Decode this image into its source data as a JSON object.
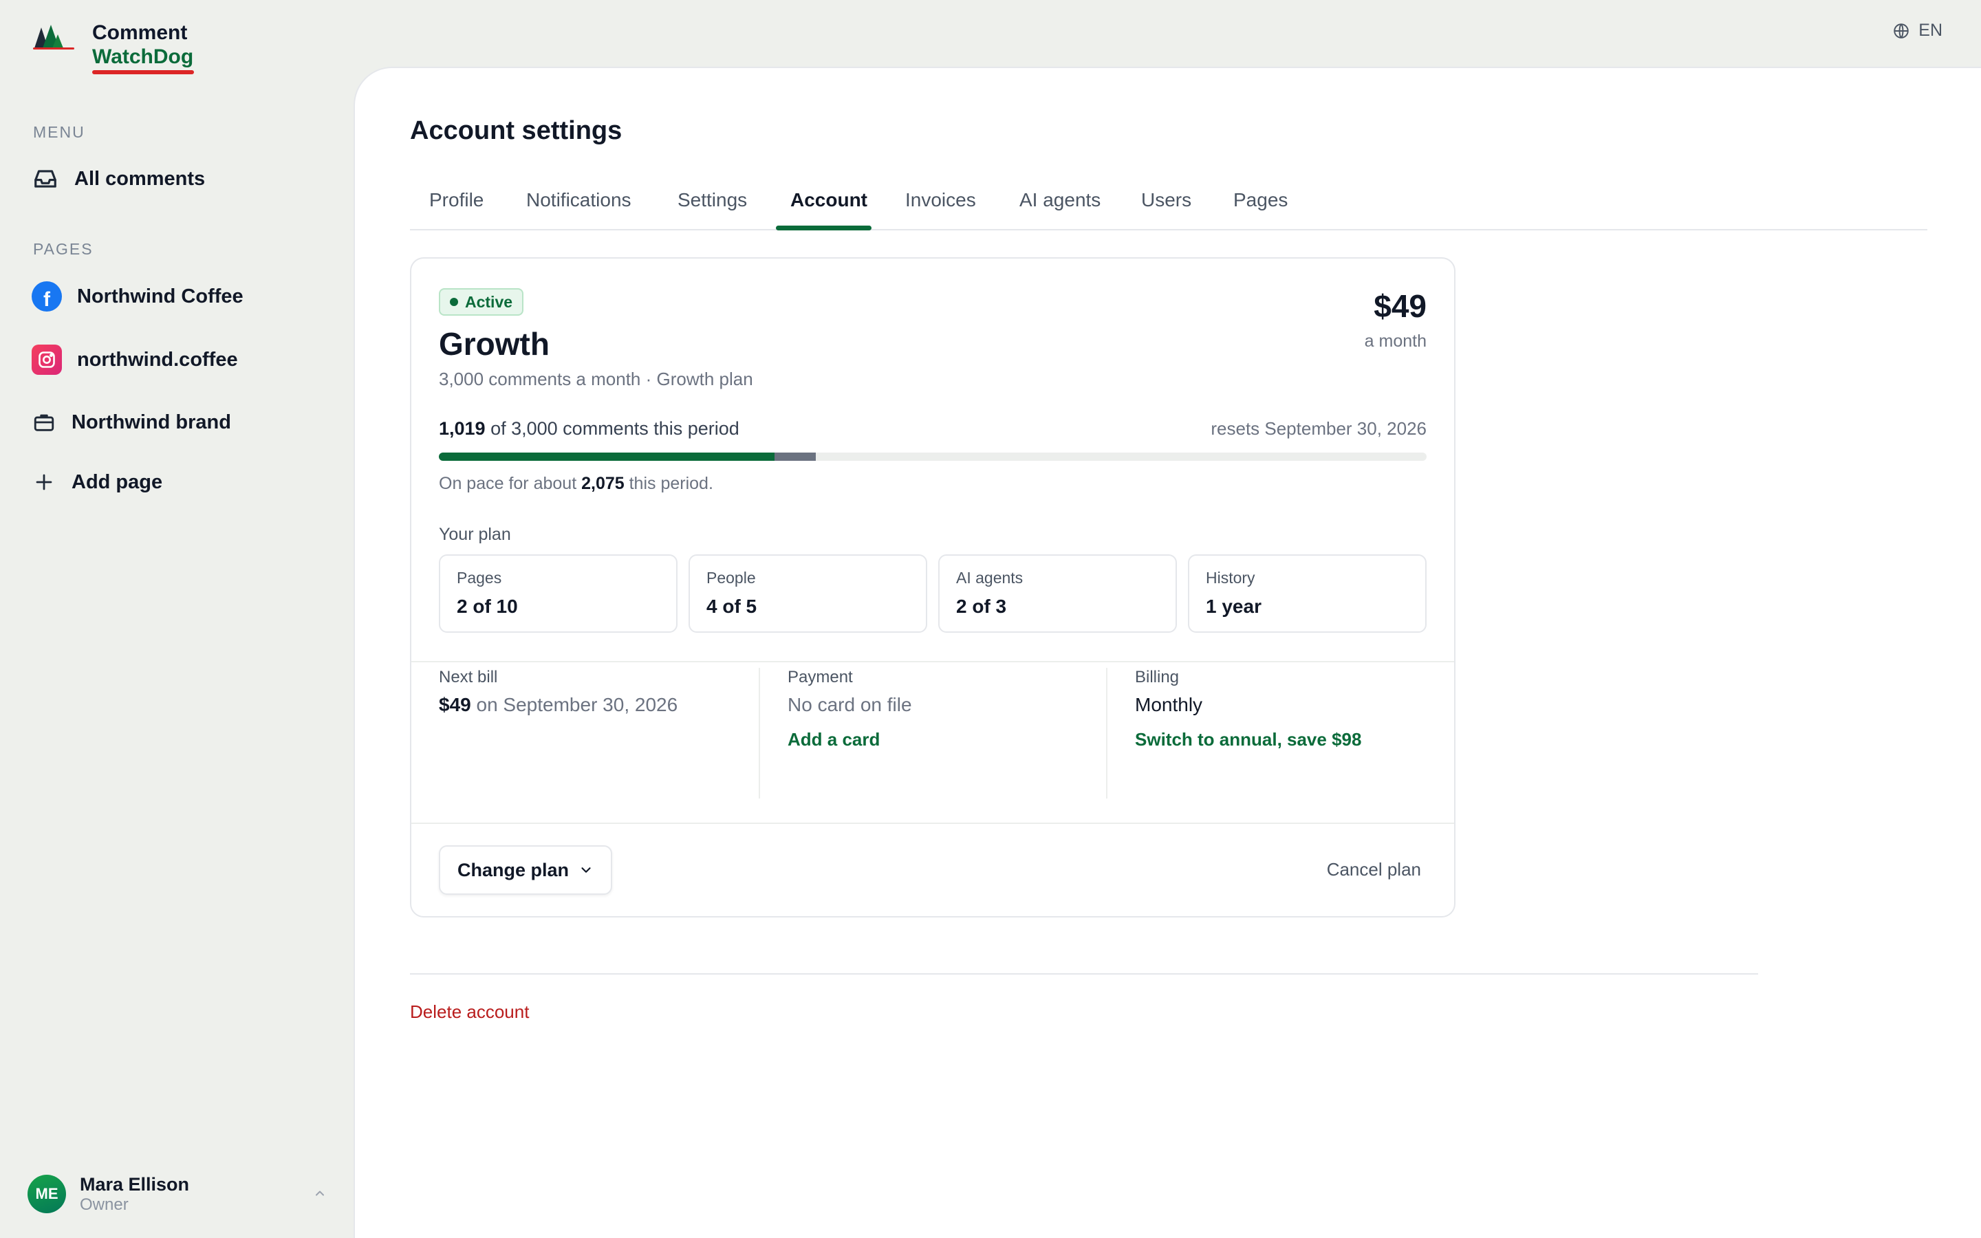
{
  "brand": {
    "line1": "Comment",
    "line2": "WatchDog"
  },
  "language": {
    "label": "EN",
    "icon": "globe-icon"
  },
  "sidebar": {
    "menu_label": "MENU",
    "menu_items": [
      {
        "label": "All comments",
        "icon": "inbox-icon"
      }
    ],
    "pages_label": "PAGES",
    "pages": [
      {
        "label": "Northwind Coffee",
        "icon": "facebook-icon"
      },
      {
        "label": "northwind.coffee",
        "icon": "instagram-icon"
      },
      {
        "label": "Northwind brand",
        "icon": "briefcase-icon"
      },
      {
        "label": "Add page",
        "icon": "plus-icon"
      }
    ]
  },
  "user": {
    "initials": "ME",
    "name": "Mara Ellison",
    "role": "Owner"
  },
  "main": {
    "title": "Account settings",
    "tabs": [
      "Profile",
      "Notifications",
      "Settings",
      "Account",
      "Invoices",
      "AI agents",
      "Users",
      "Pages"
    ],
    "active_tab": "Account"
  },
  "plan": {
    "status": "Active",
    "name": "Growth",
    "description": "3,000 comments a month · Growth plan",
    "price": "$49",
    "period": "a month",
    "usage": {
      "used": "1,019",
      "text": "of 3,000 comments this period",
      "reset": "resets September 30, 2026",
      "used_fraction": 0.3397,
      "projected_fraction": 0.3817,
      "pace_prefix": "On pace for about",
      "pace_value": "2,075",
      "pace_suffix": "this period."
    },
    "your_plan_label": "Your plan",
    "stats": [
      {
        "label": "Pages",
        "value": "2 of 10"
      },
      {
        "label": "People",
        "value": "4 of 5"
      },
      {
        "label": "AI agents",
        "value": "2 of 3"
      },
      {
        "label": "History",
        "value": "1 year"
      }
    ],
    "billing": {
      "next_bill_label": "Next bill",
      "next_bill_amount": "$49",
      "next_bill_date": "on September 30, 2026",
      "payment_label": "Payment",
      "payment_value": "No card on file",
      "payment_action": "Add a card",
      "billing_label": "Billing",
      "billing_value": "Monthly",
      "billing_action": "Switch to annual, save $98"
    },
    "change_plan": "Change plan",
    "cancel_plan": "Cancel plan"
  },
  "delete_account": "Delete account",
  "colors": {
    "accent": "#0b6b3a",
    "danger": "#b91c1c",
    "background": "#eef0ec",
    "facebook": "#1877f2",
    "instagram": "#e11d6a"
  }
}
